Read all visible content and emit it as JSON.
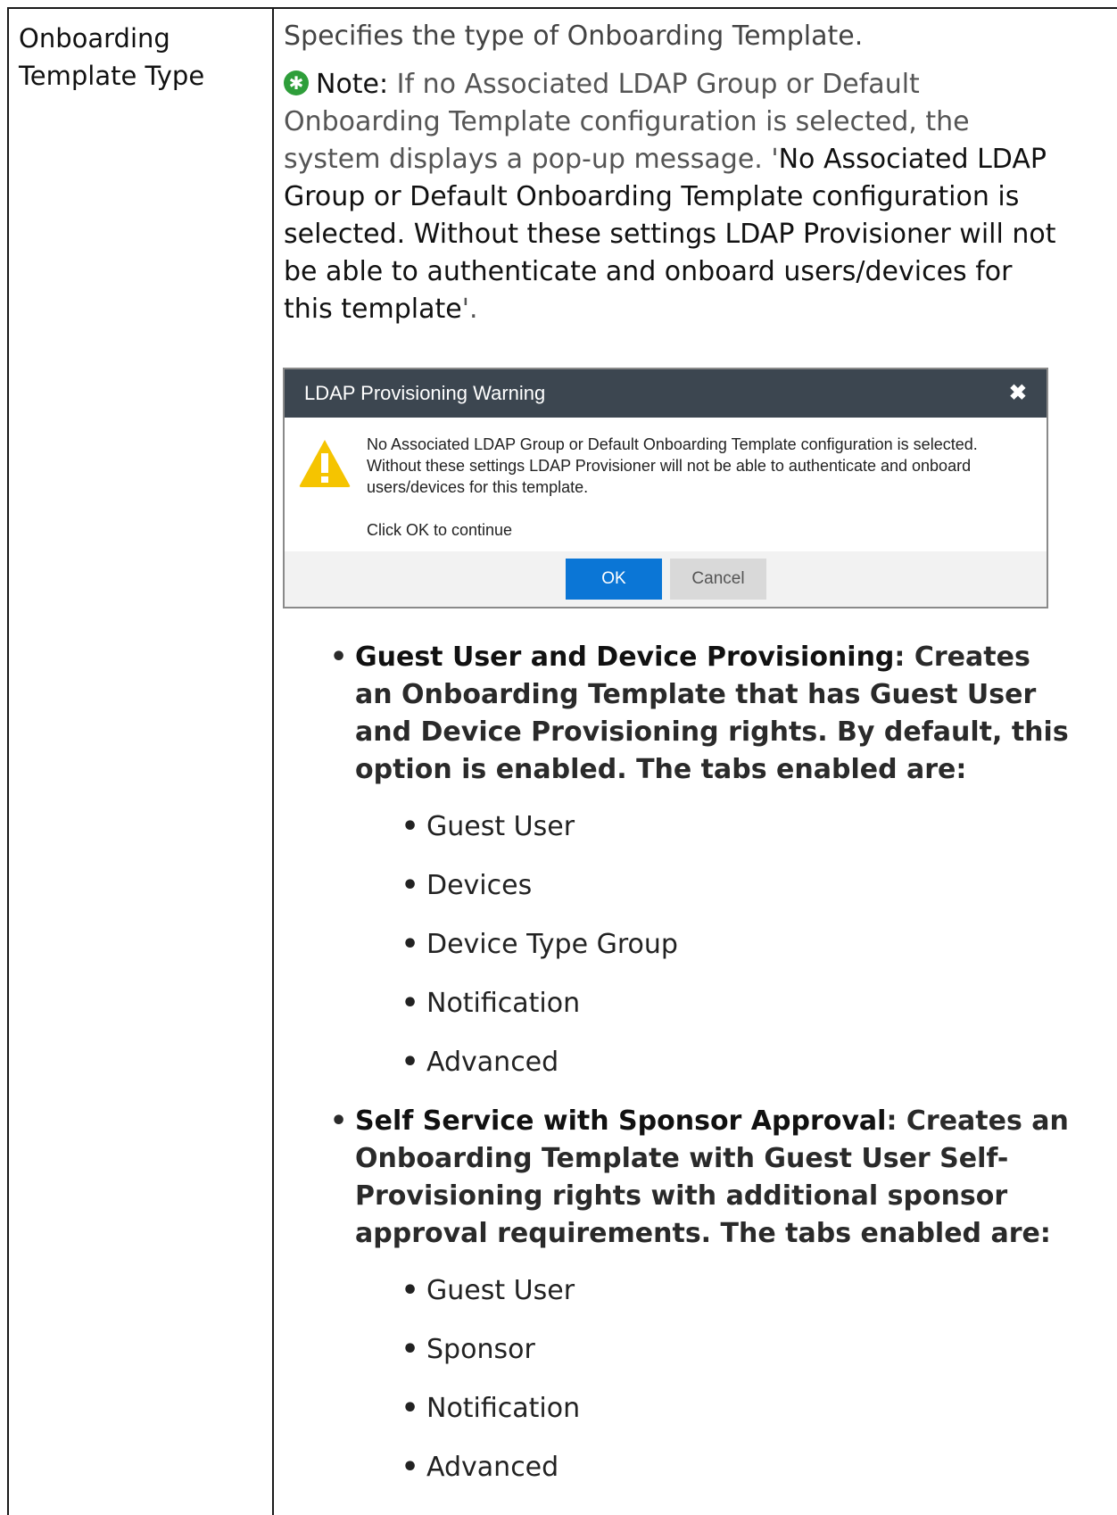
{
  "row": {
    "term": [
      "Onboarding",
      "Template Type"
    ]
  },
  "description": {
    "intro": "Specifies the type of Onboarding Template.",
    "note_label": "Note:",
    "note_text": " If no Associated LDAP Group or Default Onboarding Template configuration is selected, the system displays a pop-up message. '",
    "note_quote": "No Associated LDAP Group or Default Onboarding Template configuration is selected. Without these settings LDAP Provisioner will not be able to authenticate and onboard users/devices for this template",
    "note_end": "'."
  },
  "dialog": {
    "title": "LDAP Provisioning Warning",
    "close_glyph": "✖",
    "message": "No Associated LDAP Group or Default Onboarding Template configuration is selected. Without these settings LDAP Provisioner will not be able to authenticate and onboard users/devices for this template.",
    "continue_text": "Click OK to continue",
    "ok_label": "OK",
    "cancel_label": "Cancel",
    "icon": "warning-triangle-icon",
    "colors": {
      "header": "#3c4650",
      "ok": "#0b76d6",
      "warning": "#f5c400"
    }
  },
  "options": [
    {
      "name": "Guest User and Device Provisioning",
      "text": ": Creates an Onboarding Template that has Guest User and Device Provisioning rights. By default, this option is enabled. The tabs enabled are:",
      "tabs": [
        "Guest User",
        "Devices",
        "Device Type Group",
        "Notification",
        "Advanced"
      ]
    },
    {
      "name": "Self Service with Sponsor Approval",
      "text": ": Creates an Onboarding Template with Guest User Self-Provisioning rights with additional sponsor approval requirements. The tabs enabled are:",
      "tabs": [
        "Guest User",
        "Sponsor",
        "Notification",
        "Advanced"
      ]
    }
  ]
}
